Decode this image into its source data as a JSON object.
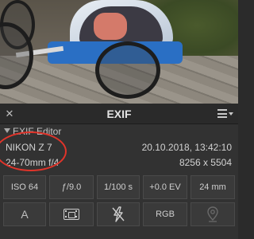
{
  "panel": {
    "title": "EXIF",
    "section_label": "EXIF Editor"
  },
  "meta": {
    "camera": "NIKON Z 7",
    "lens": "24-70mm f/4",
    "datetime": "20.10.2018, 13:42:10",
    "dimensions": "8256 x 5504"
  },
  "exposure": {
    "iso": "ISO 64",
    "aperture": "ƒ/9.0",
    "shutter": "1/100 s",
    "ev": "+0.0 EV",
    "focal": "24 mm"
  },
  "modes": {
    "exposure_mode": "A",
    "color_space": "RGB"
  },
  "icons": {
    "close": "close-icon",
    "menu": "hamburger-menu-icon",
    "collapse": "triangle-down-icon",
    "metering": "matrix-metering-icon",
    "flash": "flash-off-icon",
    "location": "location-pin-icon"
  },
  "colors": {
    "highlight": "#e0342a",
    "panel_bg": "#323232",
    "header_bg": "#2a2a2a"
  }
}
